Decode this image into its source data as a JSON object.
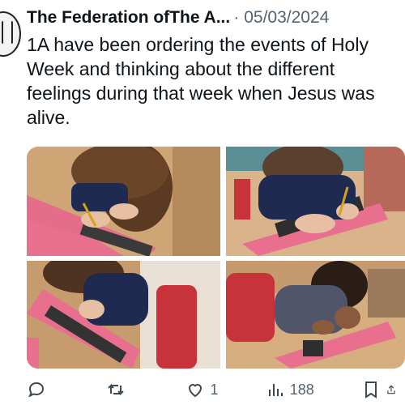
{
  "tweet": {
    "author": "The Federation ofThe A...",
    "separator": "·",
    "date": "05/03/2024",
    "text": "1A have been ordering the events of Holy Week and thinking about the different feelings during that week when Jesus was alive."
  },
  "actions": {
    "reply_count": "",
    "retweet_count": "",
    "like_count": "1",
    "view_count": "188"
  },
  "icons": {
    "reply": "reply-icon",
    "retweet": "retweet-icon",
    "like": "heart-icon",
    "views": "views-icon",
    "bookmark": "bookmark-icon",
    "share": "share-icon"
  },
  "colors": {
    "text": "#0f1419",
    "secondary": "#536471",
    "pink_paper": "#e8708e",
    "uniform_navy": "#1e2a4f",
    "chair_red": "#c8323a"
  }
}
